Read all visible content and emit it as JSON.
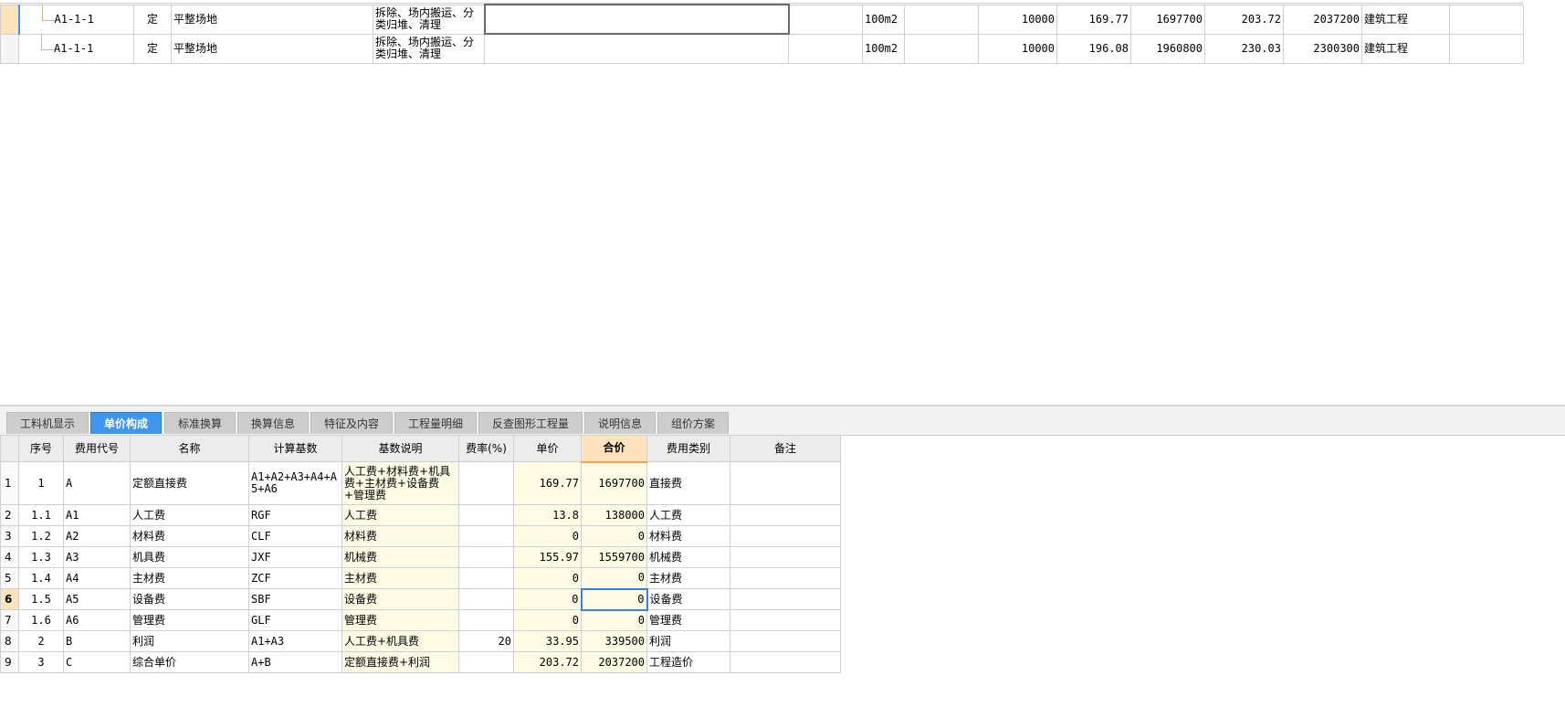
{
  "top_rows": [
    {
      "code": "A1-1-1",
      "type": "定",
      "name": "平整场地",
      "feature": "拆除、场内搬运、分类归堆、清理",
      "unit": "100m2",
      "qty": "10000",
      "unit_price": "169.77",
      "total": "1697700",
      "composite_unit_price": "203.72",
      "composite_total": "2037200",
      "category": "建筑工程"
    },
    {
      "code": "A1-1-1",
      "type": "定",
      "name": "平整场地",
      "feature": "拆除、场内搬运、分类归堆、清理",
      "unit": "100m2",
      "qty": "10000",
      "unit_price": "196.08",
      "total": "1960800",
      "composite_unit_price": "230.03",
      "composite_total": "2300300",
      "category": "建筑工程"
    }
  ],
  "tabs": [
    {
      "label": "工料机显示"
    },
    {
      "label": "单价构成"
    },
    {
      "label": "标准换算"
    },
    {
      "label": "换算信息"
    },
    {
      "label": "特征及内容"
    },
    {
      "label": "工程量明细"
    },
    {
      "label": "反查图形工程量"
    },
    {
      "label": "说明信息"
    },
    {
      "label": "组价方案"
    }
  ],
  "active_tab": "单价构成",
  "bottom_headers": {
    "seq": "序号",
    "code": "费用代号",
    "name": "名称",
    "base": "计算基数",
    "base_desc": "基数说明",
    "rate": "费率(%)",
    "unit_price": "单价",
    "total": "合价",
    "category": "费用类别",
    "note": "备注"
  },
  "bottom_rows": [
    {
      "rn": "1",
      "seq": "1",
      "code": "A",
      "name": "定额直接费",
      "base": "A1+A2+A3+A4+A5+A6",
      "base_desc": "人工费+材料费+机具费+主材费+设备费+管理费",
      "rate": "",
      "unit_price": "169.77",
      "total": "1697700",
      "category": "直接费",
      "note": ""
    },
    {
      "rn": "2",
      "seq": "1.1",
      "code": "A1",
      "name": "人工费",
      "base": "RGF",
      "base_desc": "人工费",
      "rate": "",
      "unit_price": "13.8",
      "total": "138000",
      "category": "人工费",
      "note": ""
    },
    {
      "rn": "3",
      "seq": "1.2",
      "code": "A2",
      "name": "材料费",
      "base": "CLF",
      "base_desc": "材料费",
      "rate": "",
      "unit_price": "0",
      "total": "0",
      "category": "材料费",
      "note": ""
    },
    {
      "rn": "4",
      "seq": "1.3",
      "code": "A3",
      "name": "机具费",
      "base": "JXF",
      "base_desc": "机械费",
      "rate": "",
      "unit_price": "155.97",
      "total": "1559700",
      "category": "机械费",
      "note": ""
    },
    {
      "rn": "5",
      "seq": "1.4",
      "code": "A4",
      "name": "主材费",
      "base": "ZCF",
      "base_desc": "主材费",
      "rate": "",
      "unit_price": "0",
      "total": "0",
      "category": "主材费",
      "note": ""
    },
    {
      "rn": "6",
      "seq": "1.5",
      "code": "A5",
      "name": "设备费",
      "base": "SBF",
      "base_desc": "设备费",
      "rate": "",
      "unit_price": "0",
      "total": "0",
      "category": "设备费",
      "note": ""
    },
    {
      "rn": "7",
      "seq": "1.6",
      "code": "A6",
      "name": "管理费",
      "base": "GLF",
      "base_desc": "管理费",
      "rate": "",
      "unit_price": "0",
      "total": "0",
      "category": "管理费",
      "note": ""
    },
    {
      "rn": "8",
      "seq": "2",
      "code": "B",
      "name": "利润",
      "base": "A1+A3",
      "base_desc": "人工费+机具费",
      "rate": "20",
      "unit_price": "33.95",
      "total": "339500",
      "category": "利润",
      "note": ""
    },
    {
      "rn": "9",
      "seq": "3",
      "code": "C",
      "name": "综合单价",
      "base": "A+B",
      "base_desc": "定额直接费+利润",
      "rate": "",
      "unit_price": "203.72",
      "total": "2037200",
      "category": "工程造价",
      "note": ""
    }
  ],
  "colors": {
    "tab_active": "#3e96ee",
    "selected_row": "#ffe3bd",
    "cream_cell": "#fefbe4"
  }
}
